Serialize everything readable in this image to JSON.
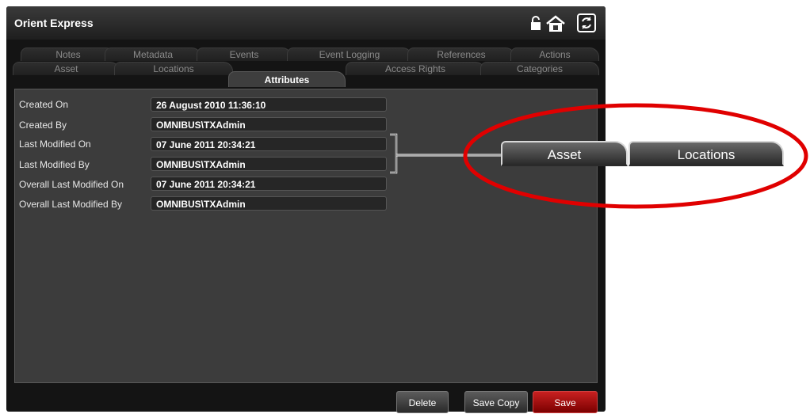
{
  "window": {
    "title": "Orient Express"
  },
  "tabs": {
    "row1": [
      "Notes",
      "Metadata",
      "Events",
      "Event Logging",
      "References",
      "Actions"
    ],
    "row2": [
      "Asset",
      "Locations",
      "Attributes",
      "Access Rights",
      "Categories"
    ],
    "active": "Attributes"
  },
  "fields": [
    {
      "label": "Created On",
      "value": "26 August 2010 11:36:10"
    },
    {
      "label": "Created By",
      "value": "OMNIBUS\\TXAdmin"
    },
    {
      "label": "Last Modified On",
      "value": "07 June 2011 20:34:21"
    },
    {
      "label": "Last Modified By",
      "value": "OMNIBUS\\TXAdmin"
    },
    {
      "label": "Overall Last Modified On",
      "value": "07 June 2011 20:34:21"
    },
    {
      "label": "Overall Last Modified By",
      "value": "OMNIBUS\\TXAdmin"
    }
  ],
  "buttons": {
    "delete": "Delete",
    "save_copy": "Save Copy",
    "save": "Save"
  },
  "callout": {
    "tabs": [
      "Asset",
      "Locations"
    ]
  },
  "icons": [
    "lock-icon",
    "home-lock-icon",
    "refresh-icon"
  ],
  "colors": {
    "save_button": "#b01010",
    "callout_ring": "#e00000",
    "panel": "#3c3c3c"
  }
}
